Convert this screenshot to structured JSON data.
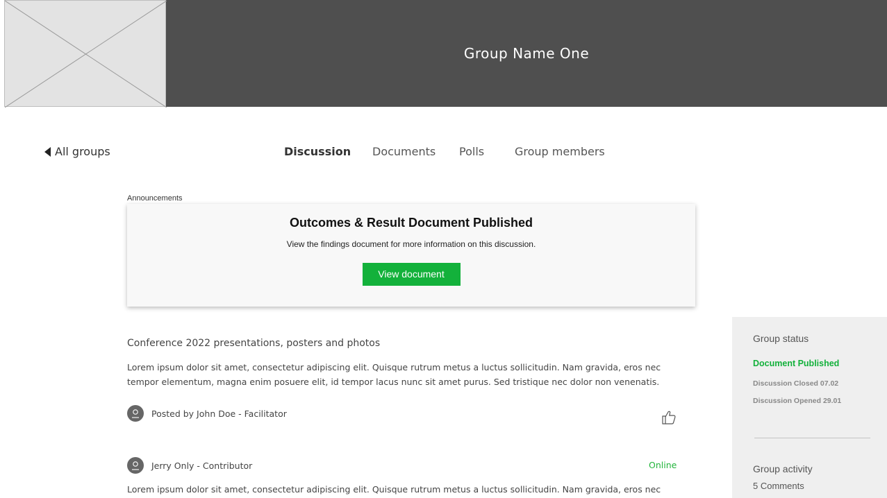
{
  "header": {
    "group_name": "Group Name One"
  },
  "nav": {
    "back_label": "All groups",
    "tabs": [
      {
        "label": "Discussion"
      },
      {
        "label": "Documents"
      },
      {
        "label": "Polls"
      },
      {
        "label": "Group members"
      }
    ]
  },
  "announcement": {
    "section_label": "Announcements",
    "title": "Outcomes & Result Document Published",
    "description": "View the findings document for more information on this discussion.",
    "button_label": "View document"
  },
  "posts": [
    {
      "title": "Conference 2022 presentations, posters and photos",
      "body_lines": [
        "Lorem ipsum dolor sit amet, consectetur adipiscing elit. Quisque rutrum metus a luctus sollicitudin. Nam gravida, eros nec",
        "tempor elementum, magna enim posuere elit, id tempor lacus nunc sit amet purus. Sed tristique nec dolor non venenatis."
      ],
      "author": "Posted by John Doe - Facilitator"
    },
    {
      "author": "Jerry Only - Contributor",
      "status": "Online",
      "body_lines": [
        "Lorem ipsum dolor sit amet, consectetur adipiscing elit. Quisque rutrum metus a luctus sollicitudin. Nam gravida, eros nec"
      ]
    }
  ],
  "sidebar": {
    "status_heading": "Group status",
    "status_main": "Document Published",
    "closed": "Discussion Closed 07.02",
    "opened": "Discussion Opened 29.01",
    "activity_heading": "Group activity",
    "comments": "5 Comments"
  },
  "colors": {
    "header_bg": "#4f4f4f",
    "accent_green": "#13b13b",
    "online_green": "#22b43b",
    "sidebar_bg": "#efefef"
  }
}
